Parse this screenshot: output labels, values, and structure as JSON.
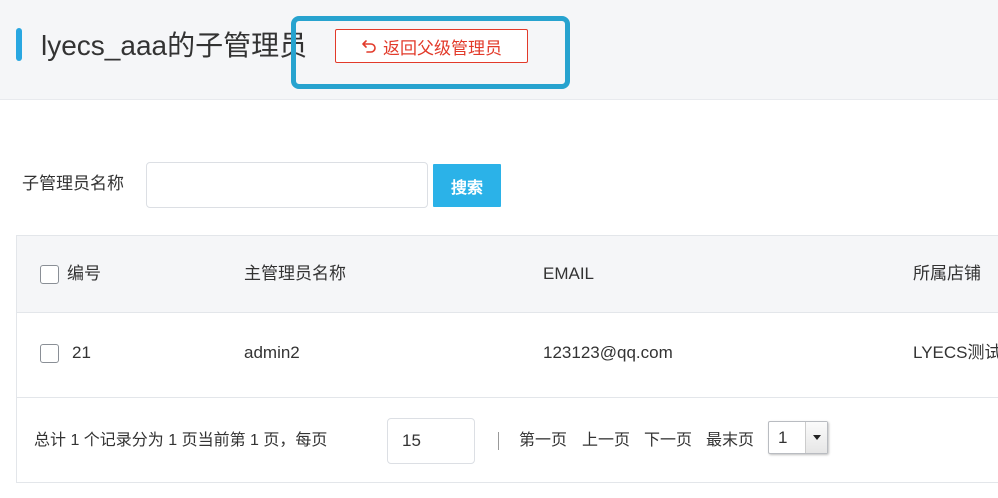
{
  "header": {
    "title": "lyecs_aaa的子管理员",
    "back_button_label": "返回父级管理员",
    "back_icon": "undo-arrow-icon",
    "accent_color": "#29a7e1",
    "highlight_color": "#27a3cf",
    "back_button_color": "#e23a2a"
  },
  "search": {
    "label": "子管理员名称",
    "value": "",
    "placeholder": "",
    "button_label": "搜索",
    "button_color": "#2bb2e8"
  },
  "table": {
    "columns": [
      "编号",
      "主管理员名称",
      "EMAIL",
      "所属店铺"
    ],
    "rows": [
      {
        "id": "21",
        "admin_name": "admin2",
        "email": "123123@qq.com",
        "shop": "LYECS测试"
      }
    ]
  },
  "pagination": {
    "summary": "总计 1 个记录分为 1 页当前第 1 页，每页",
    "page_size": "15",
    "first_label": "第一页",
    "prev_label": "上一页",
    "next_label": "下一页",
    "last_label": "最末页",
    "current_page": "1"
  }
}
